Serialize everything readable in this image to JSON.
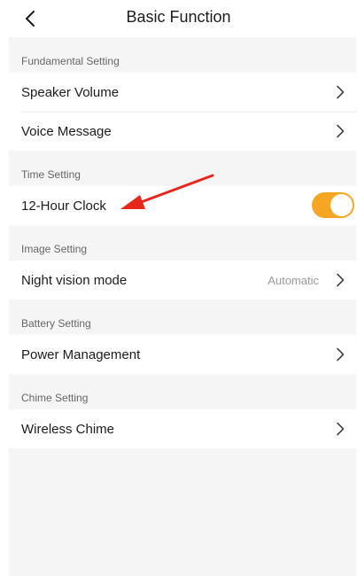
{
  "header": {
    "title": "Basic Function",
    "back_icon": "chevron-left-icon"
  },
  "sections": [
    {
      "title": "Fundamental Setting",
      "items": [
        {
          "label": "Speaker Volume",
          "type": "link"
        },
        {
          "label": "Voice Message",
          "type": "link"
        }
      ]
    },
    {
      "title": "Time Setting",
      "items": [
        {
          "label": "12-Hour Clock",
          "type": "toggle",
          "enabled": true
        }
      ]
    },
    {
      "title": "Image Setting",
      "items": [
        {
          "label": "Night vision mode",
          "type": "link",
          "value": "Automatic"
        }
      ]
    },
    {
      "title": "Battery Setting",
      "items": [
        {
          "label": "Power Management",
          "type": "link"
        }
      ]
    },
    {
      "title": "Chime Setting",
      "items": [
        {
          "label": "Wireless Chime",
          "type": "link"
        }
      ]
    }
  ],
  "colors": {
    "accent": "#f5a623",
    "annotation_arrow": "#e8271b",
    "background": "#f5f5f5"
  },
  "icons": {
    "row_chevron": "chevron-right-icon",
    "annotation": "red-arrow-annotation"
  }
}
